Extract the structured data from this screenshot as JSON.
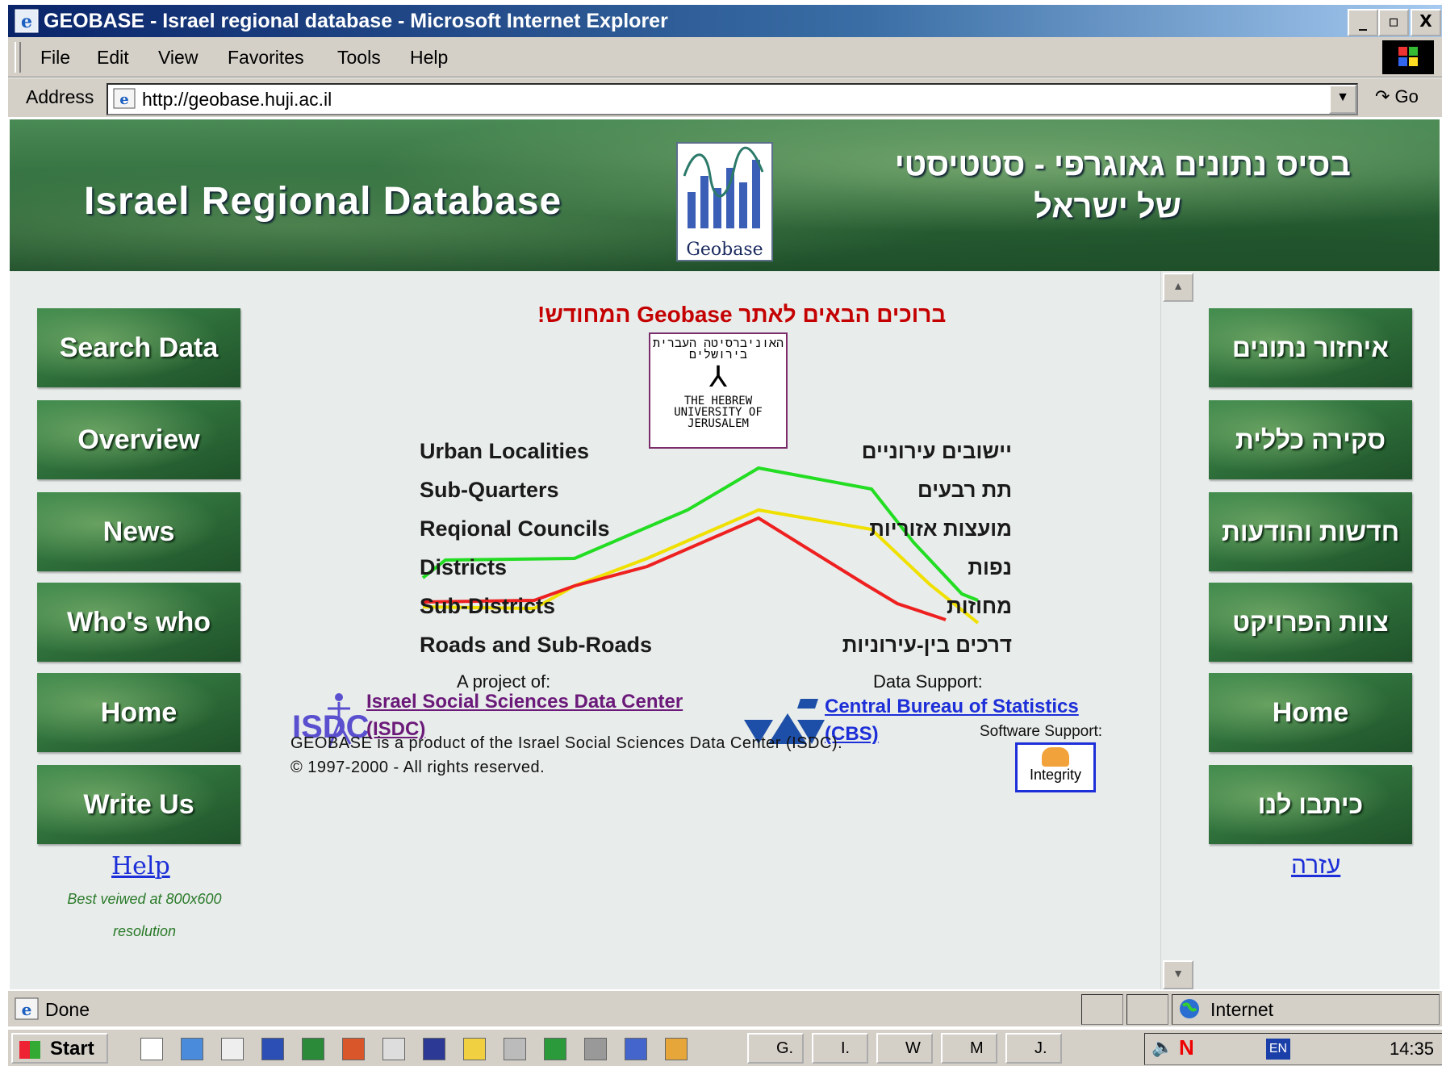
{
  "window": {
    "title": "GEOBASE - Israel regional database - Microsoft Internet Explorer",
    "minimize": "_",
    "maximize": "▫",
    "close": "X"
  },
  "menu": [
    "File",
    "Edit",
    "View",
    "Favorites",
    "Tools",
    "Help"
  ],
  "address": {
    "label": "Address",
    "url": "http://geobase.huji.ac.il",
    "go_label": "Go"
  },
  "banner": {
    "title_en": "Israel Regional Database",
    "title_he_line1": "בסיס נתונים גאוגרפי - סטטיסטי",
    "title_he_line2": "של ישראל",
    "logo_caption": "Geobase"
  },
  "nav_left": [
    "Search Data",
    "Overview",
    "News",
    "Who's who",
    "Home",
    "Write Us"
  ],
  "nav_right": [
    "איחזור נתונים",
    "סקירה כללית",
    "חדשות והודעות",
    "צוות הפרויקט",
    "Home",
    "כיתבו לנו"
  ],
  "welcome": "ברוכים הבאים לאתר Geobase המחודש!",
  "huji_logo": {
    "hebrew": "האוניברסיטה העברית בירושלים",
    "line1": "THE HEBREW",
    "line2": "UNIVERSITY OF",
    "line3": "JERUSALEM"
  },
  "units_en": [
    "Urban Localities",
    "Sub-Quarters",
    "Reqional Councils",
    "Districts",
    "Sub-Districts",
    "Roads and Sub-Roads"
  ],
  "units_he": [
    "יישובים עירוניים",
    "תת רבעים",
    "מועצות אזוריות",
    "נפות",
    "מחוזות",
    "דרכים בין-עירוניות"
  ],
  "line_colors": [
    "#22dd22",
    "#f0e000",
    "#ee2020"
  ],
  "project": {
    "label": "A project of:",
    "logo_text": "ISDC",
    "link_line1": "Israel Social Sciences Data Center",
    "link_line2": "(ISDC)"
  },
  "data_support": {
    "label": "Data Support:",
    "link_line1": "Central Bureau of Statistics",
    "link_line2": "(CBS)"
  },
  "software_support": {
    "label": "Software Support:",
    "logo_text": "Integrity"
  },
  "footer": {
    "line1": "GEOBASE is a product of the Israel Social Sciences Data Center (ISDC).",
    "line2": "© 1997-2000 - All rights reserved."
  },
  "help_en": "Help",
  "help_he": "עזרה",
  "best_viewed": [
    "Best veiwed at 800x600",
    "resolution"
  ],
  "status": {
    "text": "Done",
    "zone": "Internet"
  },
  "taskbar": {
    "start": "Start",
    "buttons": [
      "G.",
      "I.",
      "W",
      "M",
      "J."
    ],
    "clock": "14:35"
  }
}
